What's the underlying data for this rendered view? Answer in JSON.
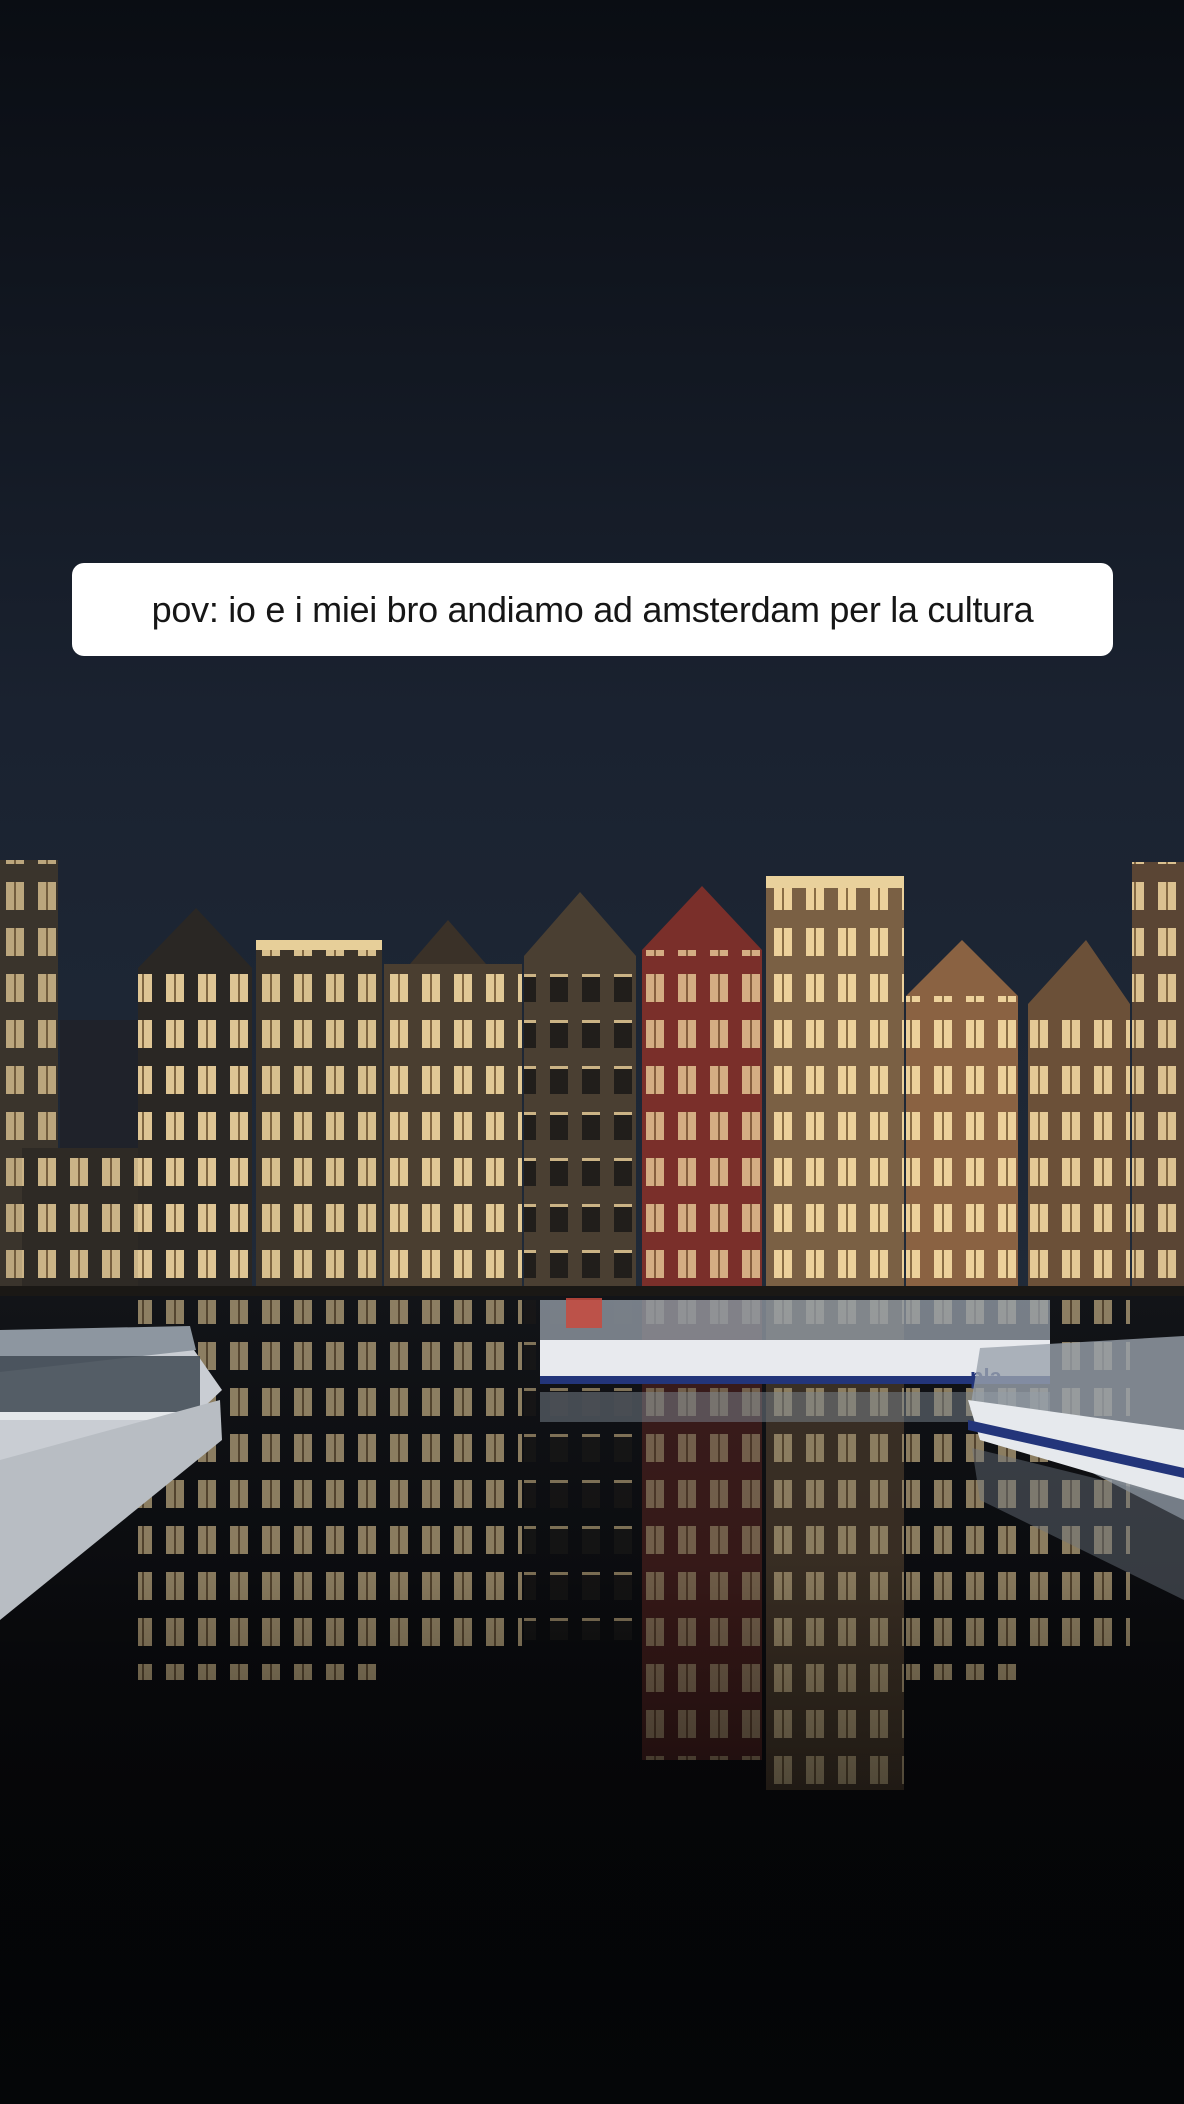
{
  "caption": {
    "text": "pov: io e i miei bro andiamo ad amsterdam per la cultura"
  },
  "photo": {
    "boat_label": "pla"
  },
  "colors": {
    "sky_top": "#0b0f16",
    "sky_mid": "#1b2331",
    "water": "#06070a",
    "red_facade": "#7a2f2a",
    "warm_light": "#f3d69a",
    "caption_bg": "#ffffff",
    "caption_text": "#161616"
  }
}
